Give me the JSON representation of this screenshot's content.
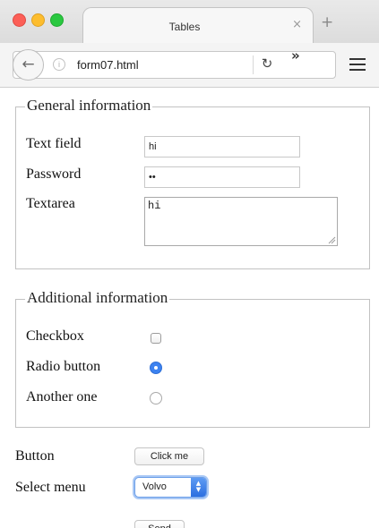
{
  "browser": {
    "tab_title": "Tables",
    "tab_close_icon": "×",
    "new_tab_icon": "+",
    "url": "form07.html",
    "back_icon": "arrow-left-icon",
    "reload_icon": "reload-icon",
    "overflow_icon": "»",
    "menu_icon": "hamburger-icon",
    "colors": {
      "close": "#fc5f57",
      "minimize": "#fdbd2e",
      "zoom": "#2ac840"
    }
  },
  "general": {
    "legend": "General information",
    "text_field_label": "Text field",
    "text_field_value": "hi",
    "password_label": "Password",
    "password_value": "••",
    "textarea_label": "Textarea",
    "textarea_value": "hi"
  },
  "additional": {
    "legend": "Additional information",
    "checkbox_label": "Checkbox",
    "checkbox_checked": false,
    "radio_label": "Radio button",
    "radio_checked": true,
    "another_label": "Another one",
    "another_checked": false,
    "accent_color": "#3c82f0"
  },
  "controls": {
    "button_label": "Button",
    "button_text": "Click me",
    "select_label": "Select menu",
    "select_value": "Volvo",
    "send_text": "Send"
  }
}
